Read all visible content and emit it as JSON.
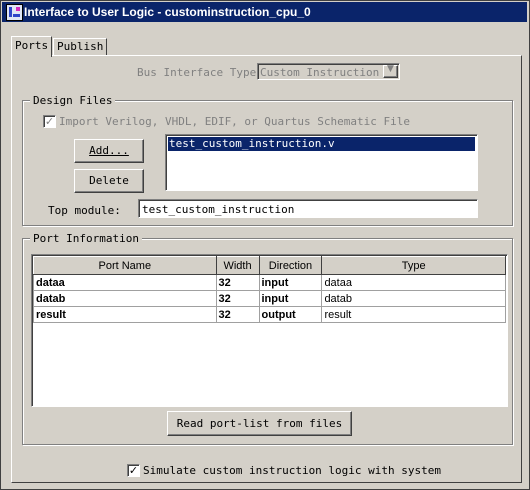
{
  "window": {
    "title": "Interface to User Logic - custominstruction_cpu_0"
  },
  "tabs": [
    {
      "label": "Ports"
    },
    {
      "label": "Publish"
    }
  ],
  "bus_interface": {
    "label": "Bus Interface Type:",
    "value": "Custom Instruction"
  },
  "design_files": {
    "legend": "Design Files",
    "import_label": "Import Verilog, VHDL, EDIF, or Quartus Schematic File",
    "import_checked": true,
    "add_label": "Add...",
    "delete_label": "Delete",
    "files": [
      "test_custom_instruction.v"
    ],
    "top_module_label": "Top module:",
    "top_module_value": "test_custom_instruction"
  },
  "port_info": {
    "legend": "Port Information",
    "columns": [
      "Port Name",
      "Width",
      "Direction",
      "Type"
    ],
    "rows": [
      {
        "name": "dataa",
        "width": "32",
        "direction": "input",
        "type": "dataa"
      },
      {
        "name": "datab",
        "width": "32",
        "direction": "input",
        "type": "datab"
      },
      {
        "name": "result",
        "width": "32",
        "direction": "output",
        "type": "result"
      }
    ],
    "read_button": "Read port-list from files"
  },
  "simulate": {
    "label": "Simulate custom instruction logic with system",
    "checked": true
  }
}
